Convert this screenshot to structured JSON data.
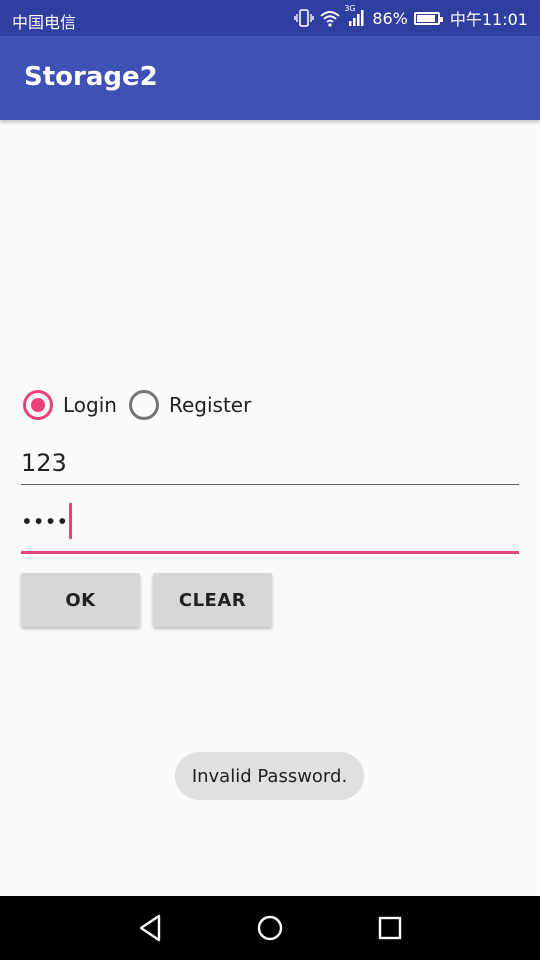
{
  "status_bar": {
    "carrier": "中国电信",
    "network": "3G",
    "battery": "86%",
    "time": "中午11:01"
  },
  "app_bar": {
    "title": "Storage2"
  },
  "mode": {
    "options": [
      {
        "label": "Login",
        "checked": true
      },
      {
        "label": "Register",
        "checked": false
      }
    ]
  },
  "form": {
    "username_value": "123",
    "password_value": "••••"
  },
  "buttons": {
    "ok_label": "OK",
    "clear_label": "CLEAR"
  },
  "toast": {
    "message": "Invalid Password."
  },
  "colors": {
    "status_bar": "#303f9f",
    "app_bar": "#3f51b5",
    "accent": "#ec407a"
  },
  "icons": {
    "status": [
      "vibrate-icon",
      "wifi-icon",
      "signal-icon",
      "battery-icon"
    ],
    "nav": [
      "back-icon",
      "home-icon",
      "recents-icon"
    ]
  }
}
